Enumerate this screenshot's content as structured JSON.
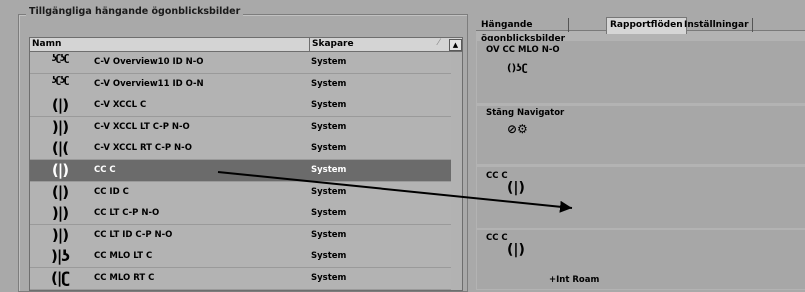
{
  "panel": {
    "title": "Tillgängliga hängande ögonblicksbilder"
  },
  "table": {
    "columns": {
      "name": "Namn",
      "creator": "Skapare"
    },
    "sort_indicator": "⁄",
    "scroll_up": "▲",
    "rows": [
      {
        "icon": "ʖʗʖʗ",
        "name": "C-V Overview10 ID N-O",
        "creator": "System"
      },
      {
        "icon": "ʖʗʖʗ",
        "name": "C-V Overview11 ID O-N",
        "creator": "System"
      },
      {
        "icon": "(|)",
        "name": "C-V XCCL C",
        "creator": "System"
      },
      {
        "icon": ")|)",
        "name": "C-V XCCL LT C-P N-O",
        "creator": "System"
      },
      {
        "icon": "(|(",
        "name": "C-V XCCL RT C-P N-O",
        "creator": "System"
      },
      {
        "icon": "(|)",
        "name": "CC C",
        "creator": "System",
        "selected": true
      },
      {
        "icon": "(|)",
        "name": "CC ID C",
        "creator": "System"
      },
      {
        "icon": ")|)",
        "name": "CC LT C-P N-O",
        "creator": "System"
      },
      {
        "icon": ")|)",
        "name": "CC LT ID C-P N-O",
        "creator": "System"
      },
      {
        "icon": ")|ʖ",
        "name": "CC MLO LT C",
        "creator": "System"
      },
      {
        "icon": "(|ʗ",
        "name": "CC MLO RT C",
        "creator": "System"
      }
    ]
  },
  "tabs": [
    "Hängande ögonblicksbilder",
    "Rapportflöden",
    "Inställningar"
  ],
  "slots": [
    {
      "title": "OV CC MLO N-O",
      "glyph": "()ʖʗ"
    },
    {
      "title": "Stäng Navigator",
      "glyph": "⊘⚙"
    },
    {
      "title": "CC C",
      "glyph": "(|)"
    },
    {
      "title": "CC C",
      "glyph": "(|)",
      "extra": "+Int Roam"
    }
  ]
}
